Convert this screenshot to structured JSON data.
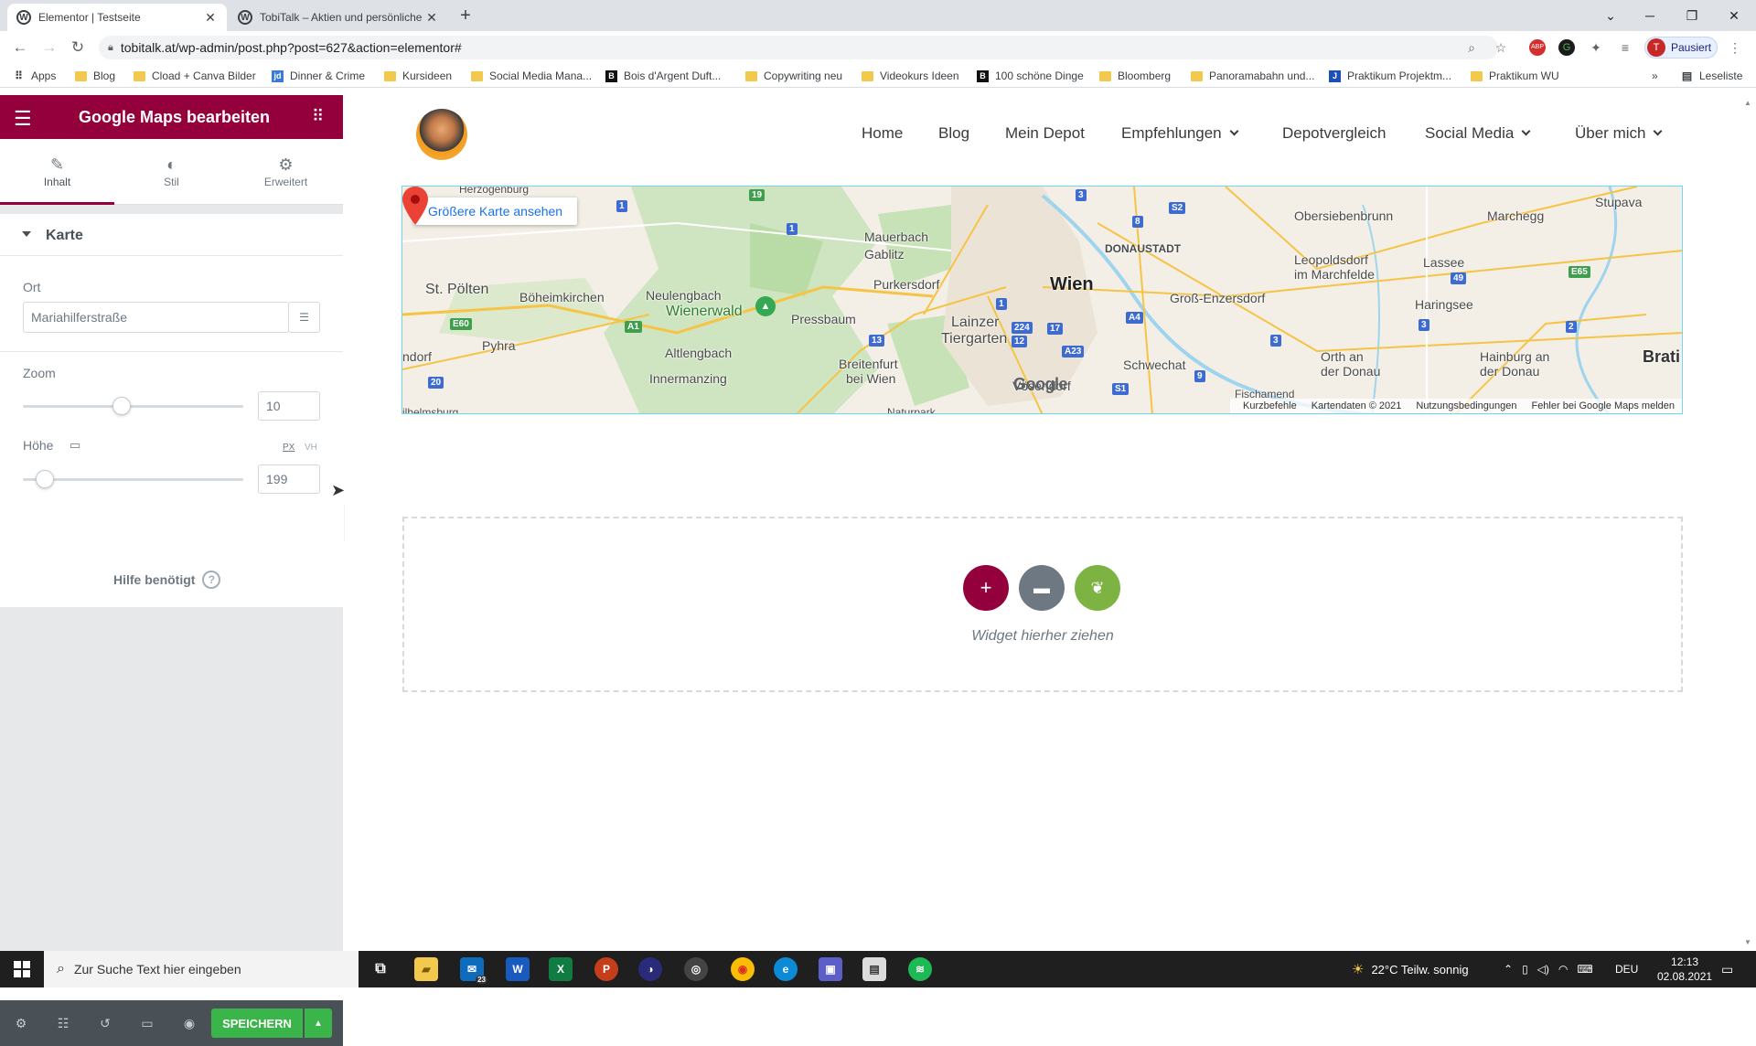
{
  "browser": {
    "tabs": [
      {
        "title": "Elementor | Testseite",
        "active": true
      },
      {
        "title": "TobiTalk – Aktien und persönliche",
        "active": false
      }
    ],
    "url": "tobitalk.at/wp-admin/post.php?post=627&action=elementor#",
    "profile_label": "Pausiert",
    "profile_initial": "T",
    "apps_label": "Apps",
    "reading_list": "Leseliste",
    "bookmarks": [
      "Blog",
      "Cload + Canva Bilder",
      "Dinner & Crime",
      "Kursideen",
      "Social Media Mana...",
      "Bois d'Argent Duft...",
      "Copywriting neu",
      "Videokurs Ideen",
      "100 schöne Dinge",
      "Bloomberg",
      "Panoramabahn und...",
      "Praktikum Projektm...",
      "Praktikum WU"
    ]
  },
  "panel": {
    "title": "Google Maps bearbeiten",
    "tabs": [
      "Inhalt",
      "Stil",
      "Erweitert"
    ],
    "section_title": "Karte",
    "location_label": "Ort",
    "location_value": "Mariahilferstraße",
    "zoom_label": "Zoom",
    "zoom_value": "10",
    "zoom_fraction": 0.45,
    "height_label": "Höhe",
    "unit_px": "PX",
    "unit_vh": "VH",
    "height_value": "199",
    "height_fraction": 0.1,
    "help_label": "Hilfe benötigt",
    "save_label": "SPEICHERN"
  },
  "site": {
    "nav": [
      "Home",
      "Blog",
      "Mein Depot",
      "Empfehlungen",
      "Depotvergleich",
      "Social Media",
      "Über mich"
    ],
    "nav_dropdowns": [
      "Empfehlungen",
      "Social Media",
      "Über mich"
    ]
  },
  "map": {
    "bigger_map": "Größere Karte ansehen",
    "google": "Google",
    "footer": [
      "Kurzbefehle",
      "Kartendaten © 2021",
      "Nutzungsbedingungen",
      "Fehler bei Google Maps melden"
    ],
    "places": {
      "herzogenburg": "Herzogenburg",
      "st_poelten": "St. Pölten",
      "boeheimkirchen": "Böheimkirchen",
      "neulengbach": "Neulengbach",
      "wienerwald": "Wienerwald",
      "pressbaum": "Pressbaum",
      "mauerbach": "Mauerbach",
      "gablitz": "Gablitz",
      "purkersdorf": "Purkersdorf",
      "lainzer": "Lainzer",
      "tiergarten": "Tiergarten",
      "wien": "Wien",
      "donaustadt": "DONAUSTADT",
      "gross_enzersdorf": "Groß-Enzersdorf",
      "obersiebenbrunn": "Obersiebenbrunn",
      "leopoldsdorf": "Leopoldsdorf",
      "im_marchfelde": "im Marchfelde",
      "lassee": "Lassee",
      "marchegg": "Marchegg",
      "stupava": "Stupava",
      "haringsee": "Haringsee",
      "pyhra": "Pyhra",
      "altlengbach": "Altlengbach",
      "innermanzing": "Innermanzing",
      "breitenfurt": "Breitenfurt",
      "bei_wien": "bei Wien",
      "schwechat": "Schwechat",
      "voesendorf": "Vösendorf",
      "orth": "Orth an",
      "der_donau": "der Donau",
      "hainburg": "Hainburg an",
      "der_donau2": "der Donau",
      "brati": "Brati",
      "ndorf": "ndorf",
      "fischamend": "Fischamend",
      "naturpark": "Naturpark",
      "ilbelmsburg": "ilhelmsburg"
    },
    "shields": [
      "19",
      "1",
      "1",
      "3",
      "8",
      "S2",
      "E60",
      "A1",
      "13",
      "1",
      "224",
      "17",
      "12",
      "A23",
      "A4",
      "9",
      "S1",
      "20",
      "3",
      "3",
      "49",
      "E65",
      "2"
    ]
  },
  "dropzone": {
    "text": "Widget hierher ziehen"
  },
  "taskbar": {
    "search_placeholder": "Zur Suche Text hier eingeben",
    "weather": "22°C  Teilw. sonnig",
    "lang": "DEU",
    "time": "12:13",
    "date": "02.08.2021",
    "mail_badge": "23"
  }
}
